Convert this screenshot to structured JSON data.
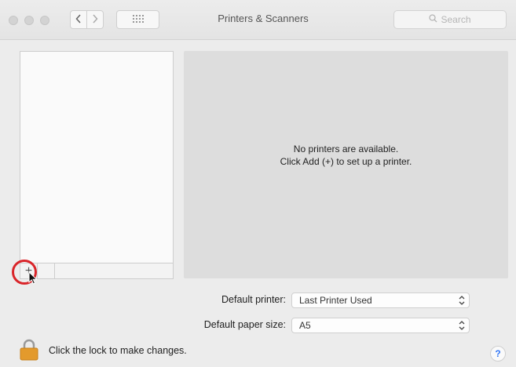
{
  "window": {
    "title": "Printers & Scanners"
  },
  "toolbar": {
    "back_icon": "chevron-left-icon",
    "forward_icon": "chevron-right-icon",
    "grid_icon": "grid-icon",
    "search_placeholder": "Search"
  },
  "printer_list": {
    "add_button": "+",
    "items": []
  },
  "detail": {
    "line1": "No printers are available.",
    "line2": "Click Add (+) to set up a printer."
  },
  "settings": {
    "default_printer_label": "Default printer:",
    "default_printer_value": "Last Printer Used",
    "paper_size_label": "Default paper size:",
    "paper_size_value": "A5"
  },
  "footer": {
    "lock_text": "Click the lock to make changes.",
    "help_label": "?"
  },
  "colors": {
    "highlight": "#d9252a",
    "lock": "#e39a2c",
    "help": "#3478f6"
  }
}
